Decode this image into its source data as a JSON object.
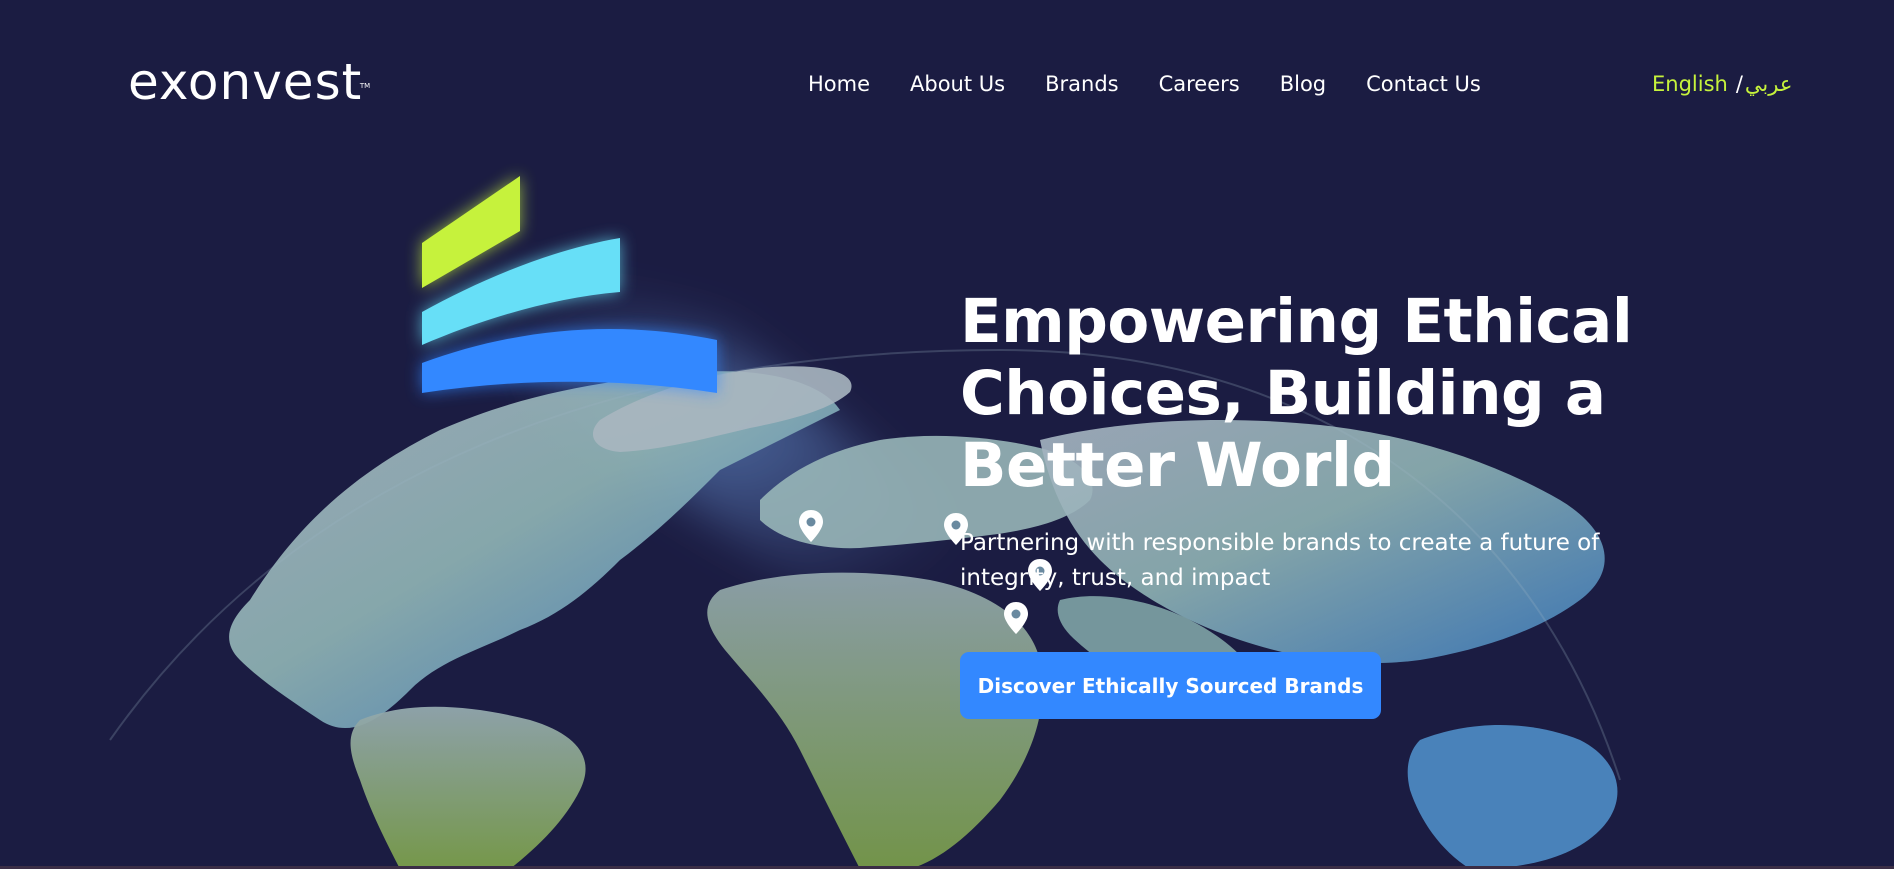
{
  "brand": {
    "name": "exonvest",
    "trademark": "TM"
  },
  "nav": {
    "items": [
      {
        "label": "Home"
      },
      {
        "label": "About Us"
      },
      {
        "label": "Brands"
      },
      {
        "label": "Careers"
      },
      {
        "label": "Blog"
      },
      {
        "label": "Contact Us"
      }
    ]
  },
  "language": {
    "english": "English",
    "separator": "/",
    "arabic": "عربي",
    "active_color": "#c6f23c"
  },
  "hero": {
    "title": "Empowering Ethical Choices, Building a Better World",
    "subtitle": "Partnering with responsible brands to create a future of integrity, trust, and impact",
    "cta_label": "Discover Ethically Sourced Brands"
  },
  "colors": {
    "background": "#1b1c42",
    "accent_lime": "#c6f23c",
    "accent_cyan": "#67dff7",
    "accent_blue": "#3388ff",
    "button": "#3388ff"
  },
  "icons": {
    "hero_emblem": "three-stripe-logo-mark",
    "map_pins": "map-pin-icon"
  }
}
